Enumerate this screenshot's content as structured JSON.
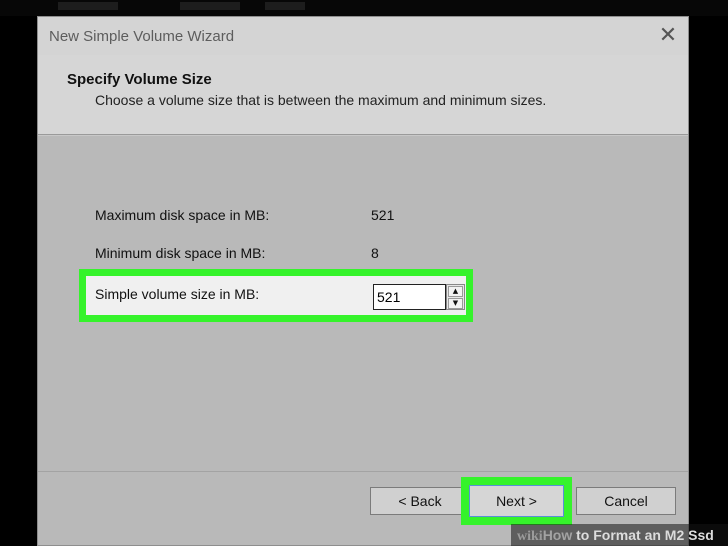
{
  "window": {
    "title": "New Simple Volume Wizard",
    "close_icon": "close-icon"
  },
  "header": {
    "title": "Specify Volume Size",
    "subtitle": "Choose a volume size that is between the maximum and minimum sizes."
  },
  "fields": {
    "max_label": "Maximum disk space in MB:",
    "max_value": "521",
    "min_label": "Minimum disk space in MB:",
    "min_value": "8",
    "size_label": "Simple volume size in MB:",
    "size_value": "521"
  },
  "buttons": {
    "back": "< Back",
    "next": "Next >",
    "cancel": "Cancel"
  },
  "watermark": {
    "wiki": "wiki",
    "how": "How",
    "rest": " to Format an M2 Ssd"
  },
  "colors": {
    "highlight": "#35f32b"
  }
}
